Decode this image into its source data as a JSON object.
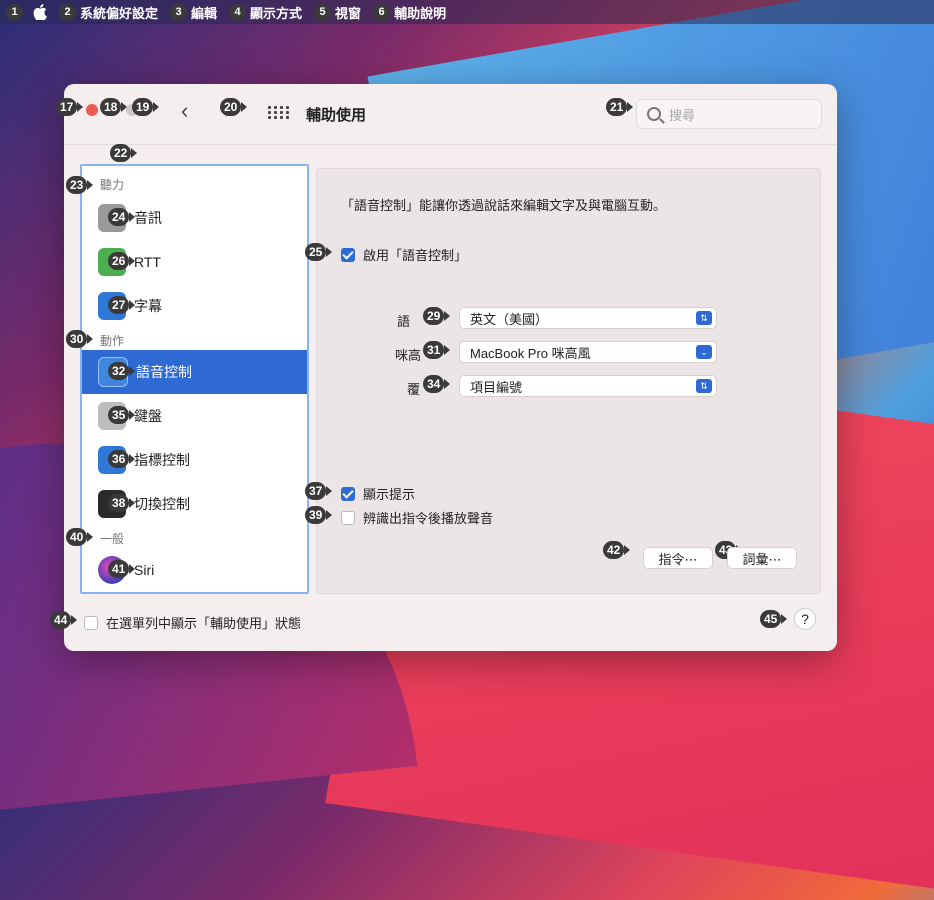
{
  "menubar": {
    "items": [
      {
        "badge": "1",
        "label": ""
      },
      {
        "badge": "2",
        "label": "系統偏好設定"
      },
      {
        "badge": "3",
        "label": "編輯"
      },
      {
        "badge": "4",
        "label": "顯示方式"
      },
      {
        "badge": "5",
        "label": "視窗"
      },
      {
        "badge": "6",
        "label": "輔助說明"
      }
    ]
  },
  "window": {
    "title": "輔助使用",
    "search_placeholder": "搜尋",
    "badges": {
      "close": "17",
      "minimize": "18",
      "zoom": "19",
      "grid": "20",
      "search": "21",
      "sidebar": "22"
    }
  },
  "sidebar": {
    "sections": [
      {
        "badge": "23",
        "label": "聽力"
      },
      {
        "badge": "30",
        "label": "動作"
      },
      {
        "badge": "40",
        "label": "一般"
      }
    ],
    "items": [
      {
        "badge": "24",
        "label": "音訊",
        "color": "#9a9a9a"
      },
      {
        "badge": "26",
        "label": "RTT",
        "color": "#4cae4f"
      },
      {
        "badge": "27",
        "label": "字幕",
        "color": "#2f78d6"
      },
      {
        "badge": "32",
        "label": "語音控制",
        "color": "#3f86e0"
      },
      {
        "badge": "35",
        "label": "鍵盤",
        "color": "#bdbdbd"
      },
      {
        "badge": "36",
        "label": "指標控制",
        "color": "#2f78d6"
      },
      {
        "badge": "38",
        "label": "切換控制",
        "color": "#2b2b2b"
      },
      {
        "badge": "41",
        "label": "Siri",
        "color": "#6a3fb8"
      }
    ]
  },
  "panel": {
    "description": "「語音控制」能讓你透過說話來編輯文字及與電腦互動。",
    "enable": {
      "badge": "25",
      "label": "啟用「語音控制」",
      "checked": true
    },
    "language": {
      "label": "語",
      "badge": "29",
      "value": "英文（美國）"
    },
    "microphone": {
      "label": "咪高",
      "badge": "31",
      "value": "MacBook Pro 咪高風"
    },
    "overlay": {
      "label": "覆",
      "badge": "34",
      "value": "項目編號"
    },
    "show_hints": {
      "badge": "37",
      "label": "顯示提示",
      "checked": true
    },
    "play_sound": {
      "badge": "39",
      "label": "辨識出指令後播放聲音",
      "checked": false
    },
    "commands_button": {
      "badge": "42",
      "label": "指令⋯"
    },
    "vocabulary_button": {
      "badge": "43",
      "label": "詞彙⋯"
    }
  },
  "footer": {
    "menu_status": {
      "badge": "44",
      "label": "在選單列中顯示「輔助使用」狀態",
      "checked": false
    },
    "help": {
      "badge": "45",
      "label": "?"
    }
  }
}
